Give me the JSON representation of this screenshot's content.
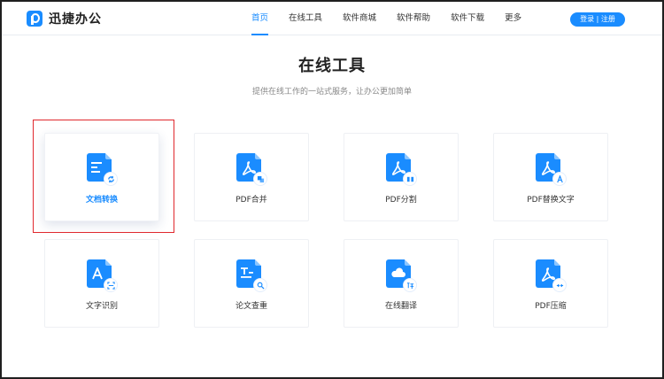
{
  "header": {
    "logo_text": "迅捷办公",
    "nav": [
      "首页",
      "在线工具",
      "软件商城",
      "软件帮助",
      "软件下载",
      "更多"
    ],
    "active_nav": "首页",
    "login_label": "登录 | 注册"
  },
  "main": {
    "title": "在线工具",
    "subtitle": "提供在线工作的一站式服务，让办公更加简单"
  },
  "tools": [
    {
      "label": "文档转换",
      "icon": "doc-convert-icon",
      "selected": true
    },
    {
      "label": "PDF合并",
      "icon": "pdf-merge-icon"
    },
    {
      "label": "PDF分割",
      "icon": "pdf-split-icon"
    },
    {
      "label": "PDF替换文字",
      "icon": "pdf-replace-text-icon"
    },
    {
      "label": "文字识别",
      "icon": "text-recognition-icon"
    },
    {
      "label": "论文查重",
      "icon": "paper-check-icon"
    },
    {
      "label": "在线翻译",
      "icon": "online-translate-icon"
    },
    {
      "label": "PDF压缩",
      "icon": "pdf-compress-icon"
    }
  ],
  "colors": {
    "accent": "#1a8cff",
    "highlight": "#e0282e"
  }
}
